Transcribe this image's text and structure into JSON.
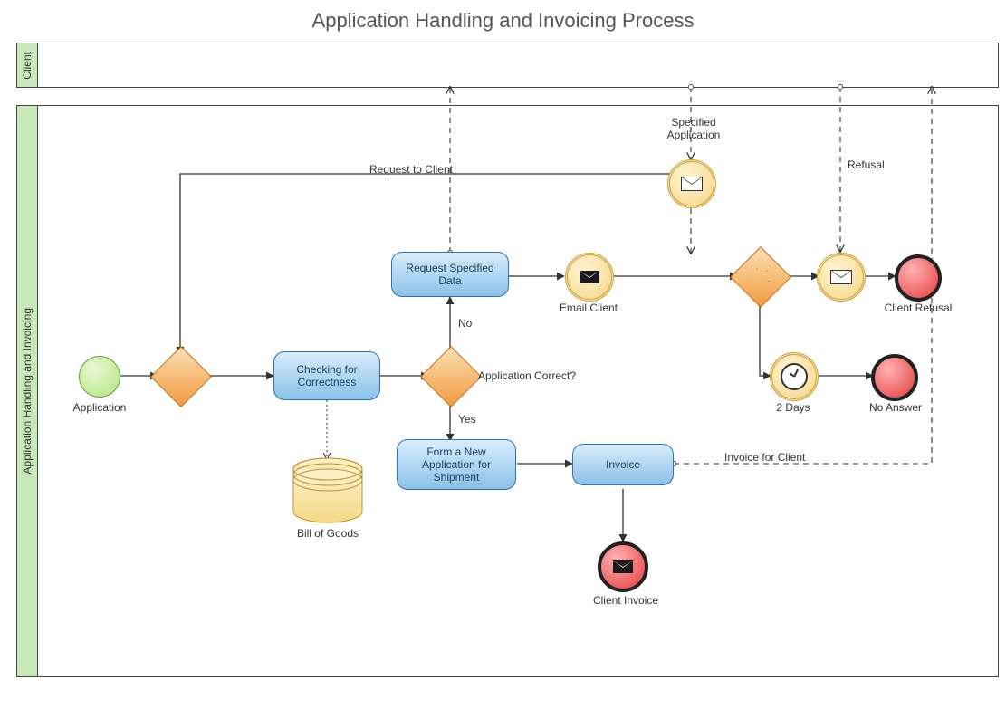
{
  "title": "Application Handling and Invoicing Process",
  "pool_client": "Client",
  "pool_main": "Application Handling and Invoicing",
  "events": {
    "start": "Application",
    "email_client": "Email Client",
    "two_days": "2 Days",
    "client_refusal": "Client Refusal",
    "no_answer": "No Answer",
    "client_invoice": "Client Invoice"
  },
  "tasks": {
    "check": "Checking for\nCorrectness",
    "request": "Request\nSpecified Data",
    "form_ship": "Form a New\nApplication for\nShipment",
    "invoice": "Invoice"
  },
  "data": {
    "bill": "Bill of Goods"
  },
  "gateways": {
    "app_correct": "Application Correct?"
  },
  "branches": {
    "no": "No",
    "yes": "Yes"
  },
  "flows": {
    "req_to_client": "Request to Client",
    "spec_app": "Specified\nApplication",
    "refusal": "Refusal",
    "inv_client": "Invoice for Client"
  }
}
